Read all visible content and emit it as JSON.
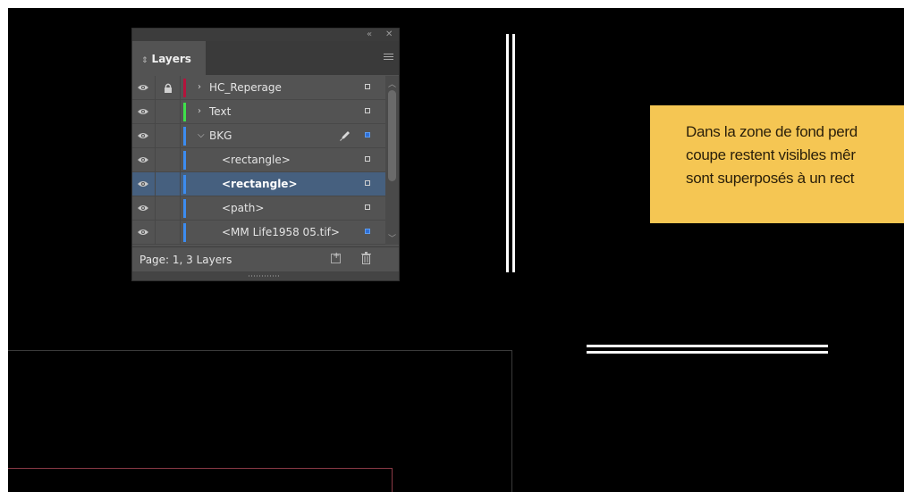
{
  "panel": {
    "collapse_icon": "double-chevron-left-icon",
    "close_icon": "close-icon",
    "tab_label": "Layers",
    "menu_icon": "hamburger-menu-icon",
    "rows": [
      {
        "label": "HC_Reperage",
        "color": "#b4143c",
        "expanded": false,
        "locked": true,
        "selected": false,
        "indent": 0
      },
      {
        "label": "Text",
        "color": "#3ee04a",
        "expanded": false,
        "locked": false,
        "selected": false,
        "indent": 0
      },
      {
        "label": "BKG",
        "color": "#3c8cf0",
        "expanded": true,
        "locked": false,
        "selected": false,
        "indent": 0
      },
      {
        "label": "<rectangle>",
        "color": "#3c8cf0",
        "locked": false,
        "selected": false,
        "indent": 1
      },
      {
        "label": "<rectangle>",
        "color": "#3c8cf0",
        "locked": false,
        "selected": true,
        "indent": 1
      },
      {
        "label": "<path>",
        "color": "#3c8cf0",
        "locked": false,
        "selected": false,
        "indent": 1
      },
      {
        "label": "<MM Life1958 05.tif>",
        "color": "#3c8cf0",
        "locked": false,
        "selected": false,
        "indent": 1
      }
    ],
    "footer_status": "Page: 1, 3 Layers"
  },
  "callout": {
    "lines": [
      "Dans la zone de fond perd",
      "coupe restent visibles mêr",
      "sont superposés à un rect"
    ],
    "background": "#f5c653"
  },
  "colors": {
    "canvas": "#000000",
    "frame_outer": "#3a3a3a",
    "frame_inner": "#8a3a46"
  }
}
